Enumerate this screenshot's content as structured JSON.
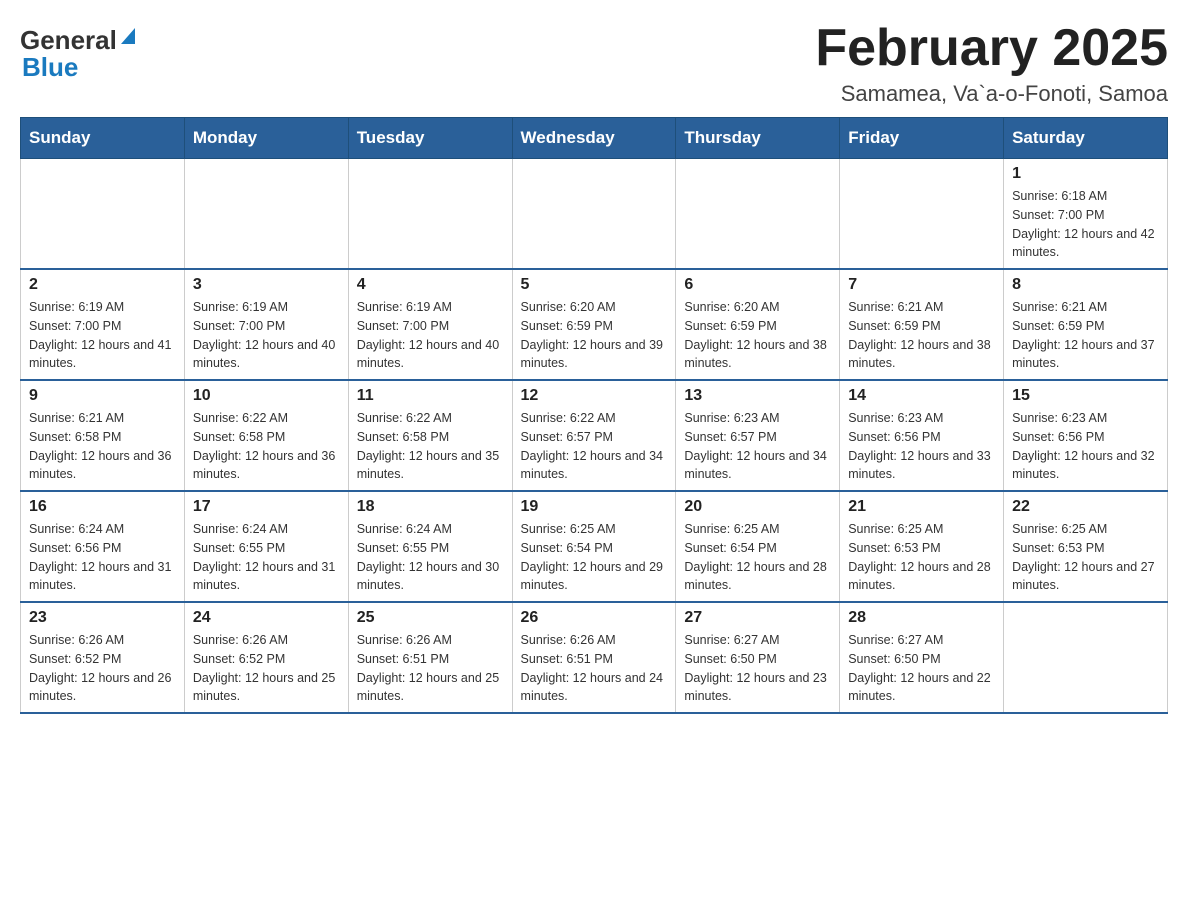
{
  "logo": {
    "general": "General",
    "blue": "Blue"
  },
  "header": {
    "title": "February 2025",
    "subtitle": "Samamea, Va`a-o-Fonoti, Samoa"
  },
  "days_of_week": [
    "Sunday",
    "Monday",
    "Tuesday",
    "Wednesday",
    "Thursday",
    "Friday",
    "Saturday"
  ],
  "weeks": [
    {
      "days": [
        {
          "number": "",
          "info": ""
        },
        {
          "number": "",
          "info": ""
        },
        {
          "number": "",
          "info": ""
        },
        {
          "number": "",
          "info": ""
        },
        {
          "number": "",
          "info": ""
        },
        {
          "number": "",
          "info": ""
        },
        {
          "number": "1",
          "info": "Sunrise: 6:18 AM\nSunset: 7:00 PM\nDaylight: 12 hours and 42 minutes."
        }
      ]
    },
    {
      "days": [
        {
          "number": "2",
          "info": "Sunrise: 6:19 AM\nSunset: 7:00 PM\nDaylight: 12 hours and 41 minutes."
        },
        {
          "number": "3",
          "info": "Sunrise: 6:19 AM\nSunset: 7:00 PM\nDaylight: 12 hours and 40 minutes."
        },
        {
          "number": "4",
          "info": "Sunrise: 6:19 AM\nSunset: 7:00 PM\nDaylight: 12 hours and 40 minutes."
        },
        {
          "number": "5",
          "info": "Sunrise: 6:20 AM\nSunset: 6:59 PM\nDaylight: 12 hours and 39 minutes."
        },
        {
          "number": "6",
          "info": "Sunrise: 6:20 AM\nSunset: 6:59 PM\nDaylight: 12 hours and 38 minutes."
        },
        {
          "number": "7",
          "info": "Sunrise: 6:21 AM\nSunset: 6:59 PM\nDaylight: 12 hours and 38 minutes."
        },
        {
          "number": "8",
          "info": "Sunrise: 6:21 AM\nSunset: 6:59 PM\nDaylight: 12 hours and 37 minutes."
        }
      ]
    },
    {
      "days": [
        {
          "number": "9",
          "info": "Sunrise: 6:21 AM\nSunset: 6:58 PM\nDaylight: 12 hours and 36 minutes."
        },
        {
          "number": "10",
          "info": "Sunrise: 6:22 AM\nSunset: 6:58 PM\nDaylight: 12 hours and 36 minutes."
        },
        {
          "number": "11",
          "info": "Sunrise: 6:22 AM\nSunset: 6:58 PM\nDaylight: 12 hours and 35 minutes."
        },
        {
          "number": "12",
          "info": "Sunrise: 6:22 AM\nSunset: 6:57 PM\nDaylight: 12 hours and 34 minutes."
        },
        {
          "number": "13",
          "info": "Sunrise: 6:23 AM\nSunset: 6:57 PM\nDaylight: 12 hours and 34 minutes."
        },
        {
          "number": "14",
          "info": "Sunrise: 6:23 AM\nSunset: 6:56 PM\nDaylight: 12 hours and 33 minutes."
        },
        {
          "number": "15",
          "info": "Sunrise: 6:23 AM\nSunset: 6:56 PM\nDaylight: 12 hours and 32 minutes."
        }
      ]
    },
    {
      "days": [
        {
          "number": "16",
          "info": "Sunrise: 6:24 AM\nSunset: 6:56 PM\nDaylight: 12 hours and 31 minutes."
        },
        {
          "number": "17",
          "info": "Sunrise: 6:24 AM\nSunset: 6:55 PM\nDaylight: 12 hours and 31 minutes."
        },
        {
          "number": "18",
          "info": "Sunrise: 6:24 AM\nSunset: 6:55 PM\nDaylight: 12 hours and 30 minutes."
        },
        {
          "number": "19",
          "info": "Sunrise: 6:25 AM\nSunset: 6:54 PM\nDaylight: 12 hours and 29 minutes."
        },
        {
          "number": "20",
          "info": "Sunrise: 6:25 AM\nSunset: 6:54 PM\nDaylight: 12 hours and 28 minutes."
        },
        {
          "number": "21",
          "info": "Sunrise: 6:25 AM\nSunset: 6:53 PM\nDaylight: 12 hours and 28 minutes."
        },
        {
          "number": "22",
          "info": "Sunrise: 6:25 AM\nSunset: 6:53 PM\nDaylight: 12 hours and 27 minutes."
        }
      ]
    },
    {
      "days": [
        {
          "number": "23",
          "info": "Sunrise: 6:26 AM\nSunset: 6:52 PM\nDaylight: 12 hours and 26 minutes."
        },
        {
          "number": "24",
          "info": "Sunrise: 6:26 AM\nSunset: 6:52 PM\nDaylight: 12 hours and 25 minutes."
        },
        {
          "number": "25",
          "info": "Sunrise: 6:26 AM\nSunset: 6:51 PM\nDaylight: 12 hours and 25 minutes."
        },
        {
          "number": "26",
          "info": "Sunrise: 6:26 AM\nSunset: 6:51 PM\nDaylight: 12 hours and 24 minutes."
        },
        {
          "number": "27",
          "info": "Sunrise: 6:27 AM\nSunset: 6:50 PM\nDaylight: 12 hours and 23 minutes."
        },
        {
          "number": "28",
          "info": "Sunrise: 6:27 AM\nSunset: 6:50 PM\nDaylight: 12 hours and 22 minutes."
        },
        {
          "number": "",
          "info": ""
        }
      ]
    }
  ]
}
